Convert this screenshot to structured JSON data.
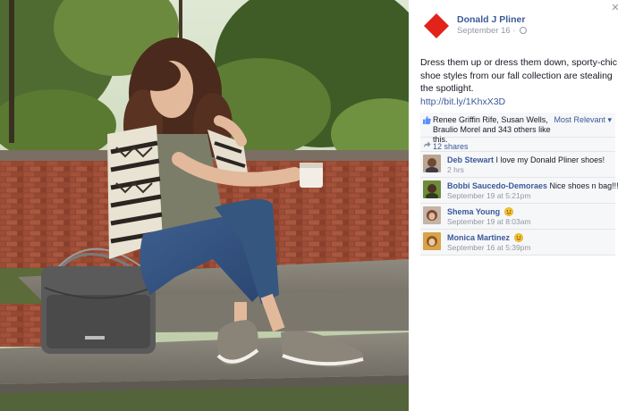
{
  "photo": {
    "alt": "Model sitting on stone steps wearing sneakers with a handbag"
  },
  "panel": {
    "close_label": "✕"
  },
  "post": {
    "page_name": "Donald J Pliner",
    "date": "September 16",
    "separator": " · ",
    "caption": "Dress them up or dress them down, sporty-chic shoe styles from our fall collection are stealing the spotlight.",
    "link": "http://bit.ly/1KhxX3D"
  },
  "ufi": {
    "likes_text": "Renee Griffin Rife, Susan Wells, Braulio Morel and 343 others like this.",
    "sort_label": "Most Relevant ▾",
    "shares_text": "12 shares"
  },
  "comments": [
    {
      "name": "Deb Stewart",
      "text": "I love my Donald Pliner shoes!",
      "time": "2 hrs",
      "emoji": false
    },
    {
      "name": "Bobbi Saucedo-Demoraes",
      "text": "Nice shoes n bag!!!",
      "time": "September 19 at 5:21pm",
      "emoji": false
    },
    {
      "name": "Shema Young",
      "text": "",
      "time": "September 19 at 8:03am",
      "emoji": true
    },
    {
      "name": "Monica Martinez",
      "text": "",
      "time": "September 16 at 5:39pm",
      "emoji": true
    }
  ],
  "colors": {
    "link_blue": "#3b5998",
    "brand_red": "#e2231a",
    "meta_gray": "#9197a3"
  }
}
